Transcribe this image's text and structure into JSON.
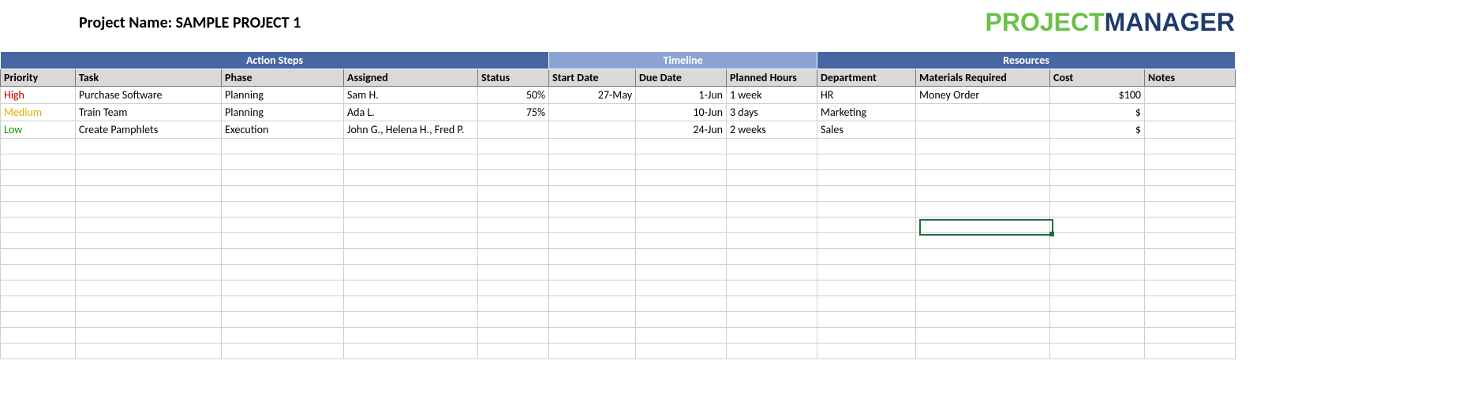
{
  "header": {
    "project_label": "Project Name: SAMPLE PROJECT 1",
    "logo_part1": "PROJECT",
    "logo_part2": "MANAGER"
  },
  "groups": {
    "action_steps": "Action Steps",
    "timeline": "Timeline",
    "resources": "Resources"
  },
  "columns": {
    "priority": "Priority",
    "task": "Task",
    "phase": "Phase",
    "assigned": "Assigned",
    "status": "Status",
    "start_date": "Start Date",
    "due_date": "Due Date",
    "planned_hours": "Planned Hours",
    "department": "Department",
    "materials": "Materials Required",
    "cost": "Cost",
    "notes": "Notes"
  },
  "rows": [
    {
      "priority": "High",
      "priority_class": "priority-high",
      "task": "Purchase Software",
      "phase": "Planning",
      "assigned": "Sam H.",
      "status": "50%",
      "start_date": "27-May",
      "due_date": "1-Jun",
      "planned_hours": "1 week",
      "department": "HR",
      "materials": "Money Order",
      "cost": "$100",
      "notes": ""
    },
    {
      "priority": "Medium",
      "priority_class": "priority-medium",
      "task": "Train Team",
      "phase": "Planning",
      "assigned": "Ada L.",
      "status": "75%",
      "start_date": "",
      "due_date": "10-Jun",
      "planned_hours": "3 days",
      "department": "Marketing",
      "materials": "",
      "cost": "$",
      "notes": ""
    },
    {
      "priority": "Low",
      "priority_class": "priority-low",
      "task": "Create Pamphlets",
      "phase": "Execution",
      "assigned": "John G., Helena H., Fred P.",
      "status": "",
      "start_date": "",
      "due_date": "24-Jun",
      "planned_hours": "2 weeks",
      "department": "Sales",
      "materials": "",
      "cost": "$",
      "notes": ""
    }
  ],
  "empty_rows": 14
}
